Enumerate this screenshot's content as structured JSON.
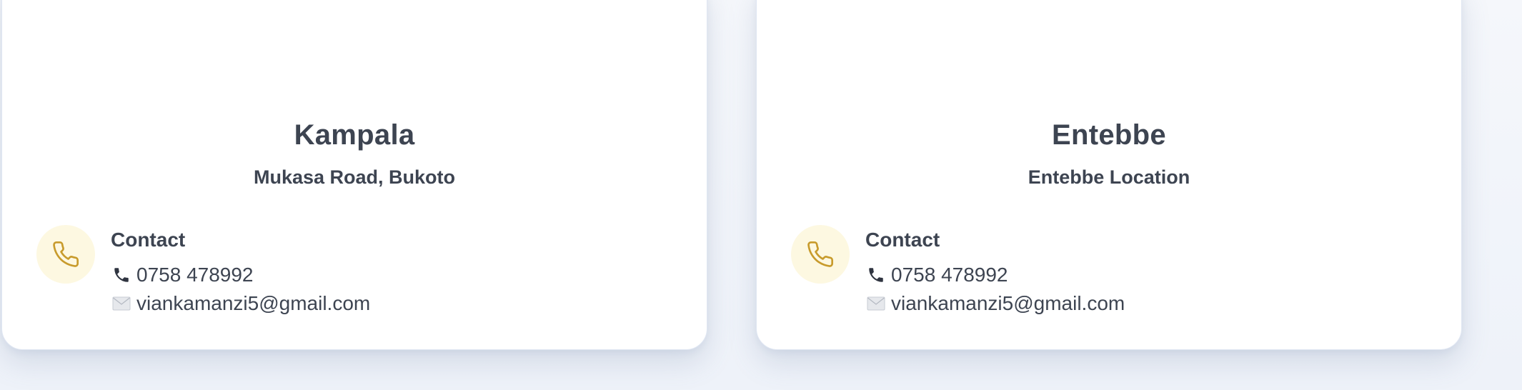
{
  "locations": [
    {
      "city": "Kampala",
      "address": "Mukasa Road, Bukoto",
      "contact_title": "Contact",
      "phone": "0758 478992",
      "email": "viankamanzi5@gmail.com"
    },
    {
      "city": "Entebbe",
      "address": "Entebbe Location",
      "contact_title": "Contact",
      "phone": "0758 478992",
      "email": "viankamanzi5@gmail.com"
    }
  ],
  "icons": {
    "contact": "phone-icon",
    "phone": "telephone-receiver-icon",
    "email": "envelope-icon"
  },
  "colors": {
    "accent": "#c89b2c",
    "accent_bg": "#fdf8e1",
    "text": "#3d4451",
    "card_bg": "#ffffff"
  }
}
